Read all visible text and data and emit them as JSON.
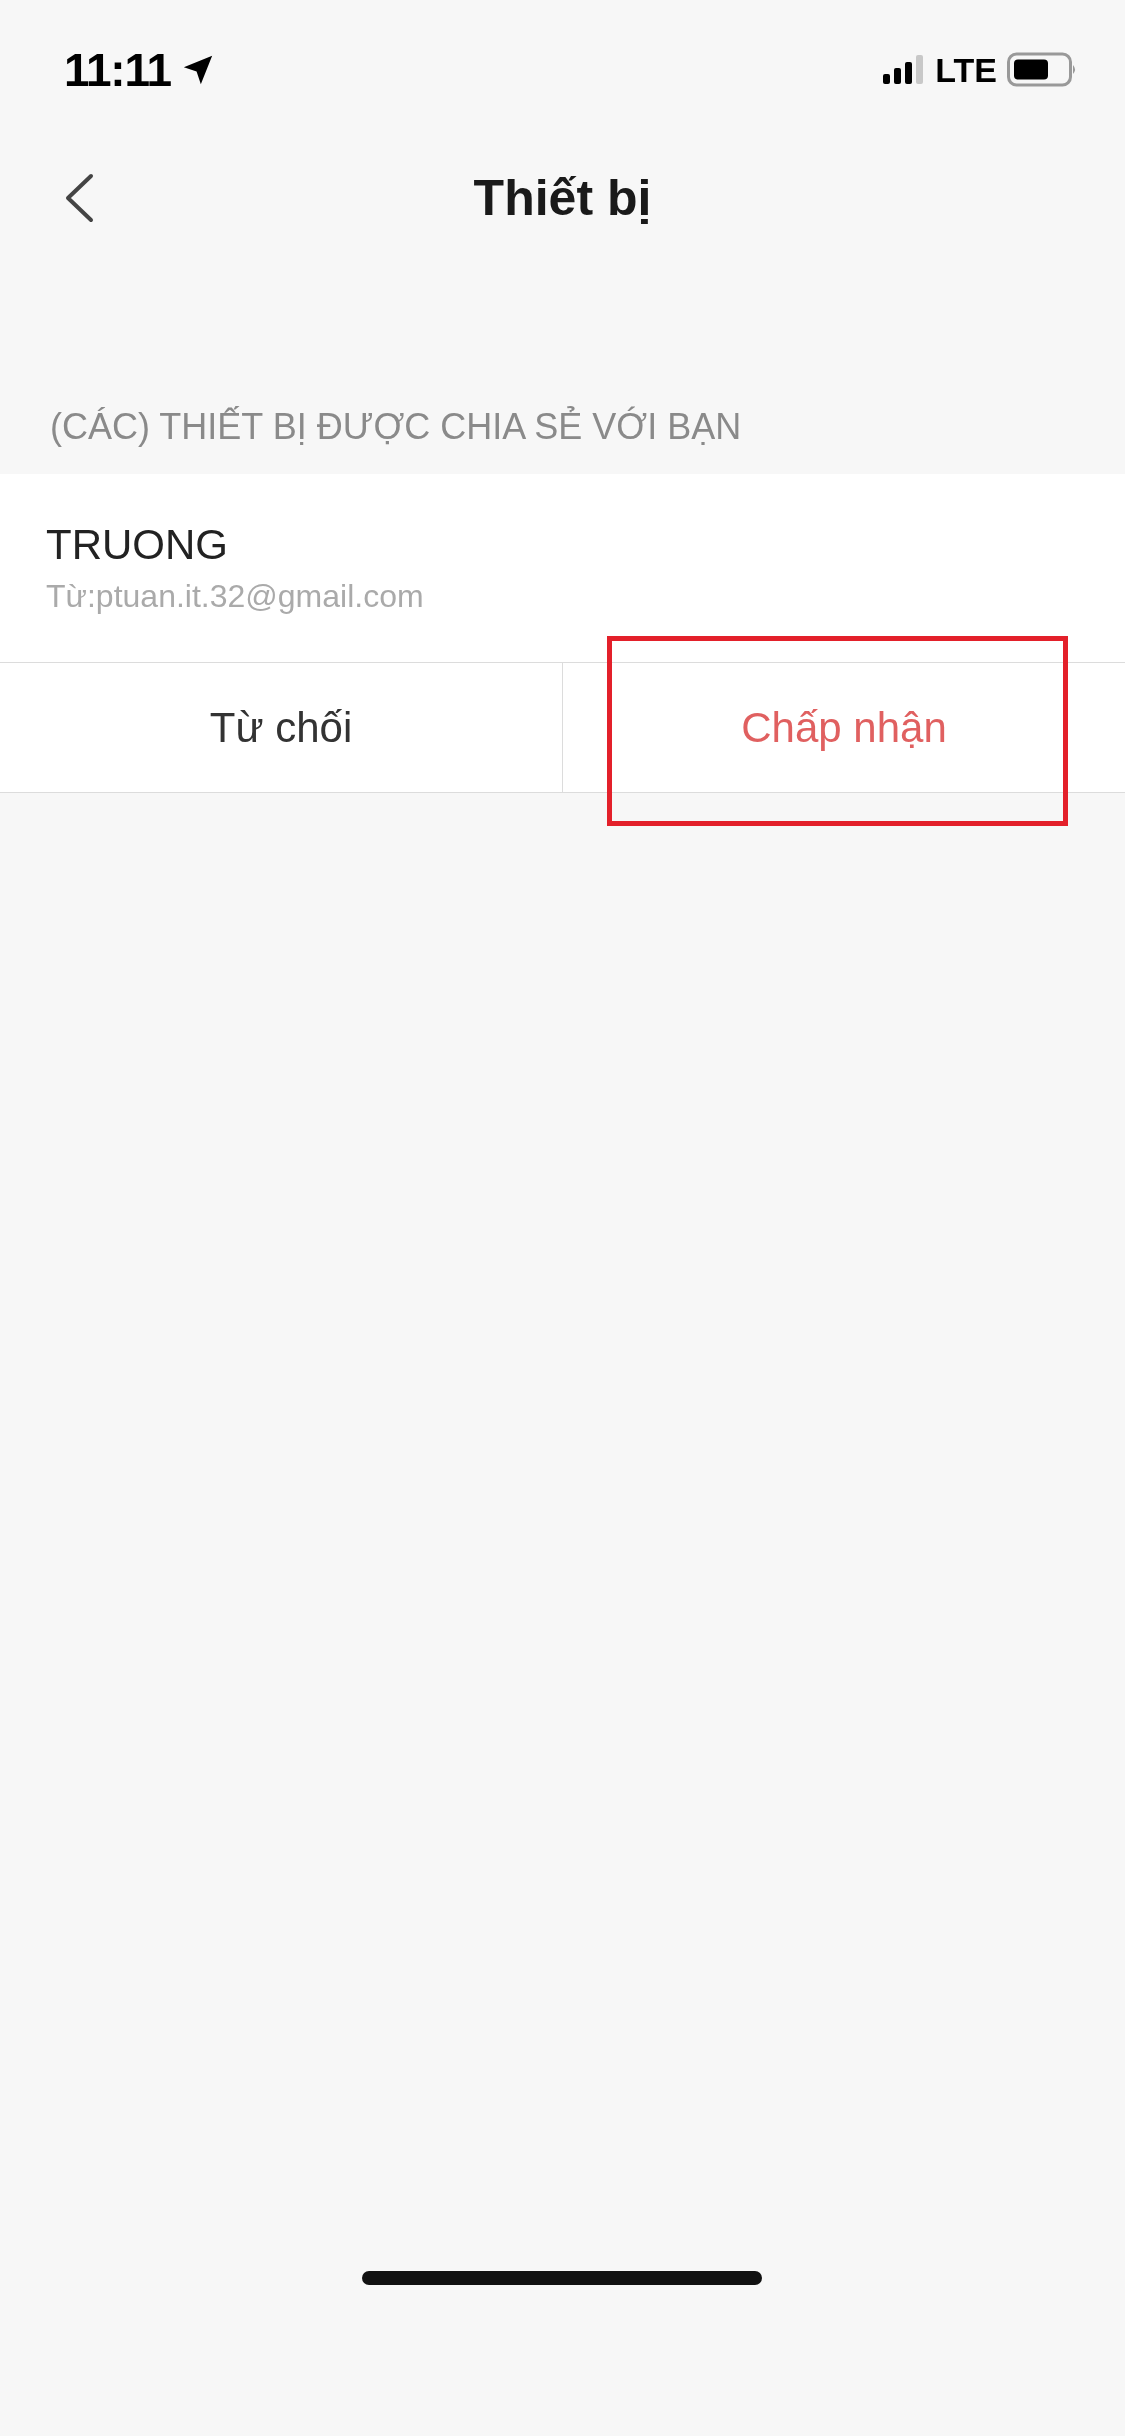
{
  "status_bar": {
    "time": "11:11",
    "network": "LTE"
  },
  "header": {
    "title": "Thiết bị"
  },
  "section": {
    "title": "(CÁC) THIẾT BỊ ĐƯỢC CHIA SẺ VỚI BẠN"
  },
  "share_request": {
    "device_name": "TRUONG",
    "from": "Từ:ptuan.it.32@gmail.com"
  },
  "actions": [
    {
      "label": "Từ chối",
      "kind": "reject",
      "highlighted": false
    },
    {
      "label": "Chấp nhận",
      "kind": "accept",
      "highlighted": true
    }
  ]
}
